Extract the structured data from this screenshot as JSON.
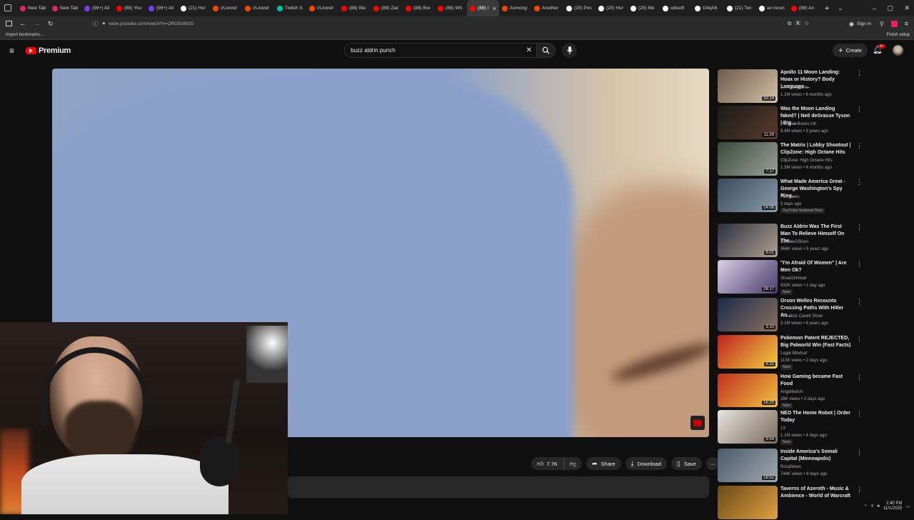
{
  "tabs": [
    {
      "label": "New Tab",
      "color": "#e0245e"
    },
    {
      "label": "New Tab",
      "color": "#e0245e"
    },
    {
      "label": "(99+) All",
      "color": "#7c3aed"
    },
    {
      "label": "(88) You",
      "color": "#ff0000"
    },
    {
      "label": "(99+) All",
      "color": "#7c3aed"
    },
    {
      "label": "(21) Hor",
      "color": "#ffffff"
    },
    {
      "label": "r/Livestr",
      "color": "#ff4500"
    },
    {
      "label": "r/Livestr",
      "color": "#ff4500"
    },
    {
      "label": "Twitch S",
      "color": "#00c2a8"
    },
    {
      "label": "r/Livestr",
      "color": "#ff4500"
    },
    {
      "label": "(88) Wa",
      "color": "#ff0000"
    },
    {
      "label": "(88) Zac",
      "color": "#ff0000"
    },
    {
      "label": "(88) Bre",
      "color": "#ff0000"
    },
    {
      "label": "(88) Wh",
      "color": "#ff0000"
    },
    {
      "label": "(88) I",
      "color": "#ff0000"
    },
    {
      "label": "Asmong",
      "color": "#ff4500"
    },
    {
      "label": "Another",
      "color": "#ff4500"
    },
    {
      "label": "(20) Pos",
      "color": "#ffffff"
    },
    {
      "label": "(20) Hor",
      "color": "#ffffff"
    },
    {
      "label": "(20) Me",
      "color": "#ffffff"
    },
    {
      "label": "ubisoft",
      "color": "#ffffff"
    },
    {
      "label": "G4qA6",
      "color": "#ffffff"
    },
    {
      "label": "(21) Twi",
      "color": "#ffffff"
    },
    {
      "label": "an incon",
      "color": "#ffffff"
    },
    {
      "label": "(88) An",
      "color": "#ff0000"
    }
  ],
  "active_tab_index": 14,
  "browser": {
    "url": "www.youtube.com/watch?v=ORO8z89zD",
    "bookmarks_label": "Import bookmarks...",
    "sign_in": "Sign in",
    "finish_setup": "Finish setup"
  },
  "youtube": {
    "logo_text": "Premium",
    "search_value": "buzz aldrin punch",
    "create_label": "Create",
    "notif_count": "9+"
  },
  "actions": {
    "likes": "7.7K",
    "share": "Share",
    "download": "Download",
    "save": "Save"
  },
  "recommendations": [
    {
      "title": "Apollo 11 Moon Landing: Hoax or History? Body Language ...",
      "channel": "Dr. G Explains",
      "stats": "1.1M views • 6 months ago",
      "duration": "33:14",
      "thumb": [
        "#6e5a4a",
        "#d3c1a8"
      ],
      "badge": ""
    },
    {
      "title": "Was the Moon Landing faked? | Neil deGrasse Tyson | Big ...",
      "channel": "Penguin Books UK",
      "stats": "9.4M views • 5 years ago",
      "duration": "11:29",
      "thumb": [
        "#1b1b1b",
        "#5a3a2a"
      ],
      "badge": ""
    },
    {
      "title": "The Matrix | Lobby Shootout | ClipZone: High Octane Hits",
      "channel": "ClipZone: High Octane Hits",
      "stats": "1.3M views • 4 months ago",
      "duration": "7:17",
      "thumb": [
        "#3a4a3a",
        "#9aa09a"
      ],
      "badge": ""
    },
    {
      "title": "What Made America Great - George Washington's Spy Ring...",
      "channel": "Fox News",
      "stats": "3 days ago",
      "duration": "14:06",
      "thumb": [
        "#3a4a5c",
        "#8a9aa8"
      ],
      "badge": "YouTube featured  New"
    },
    {
      "title": "Buzz Aldrin Was The First Man To Relieve Himself On The ...",
      "channel": "Conan O'Brien",
      "stats": "364K views • 5 years ago",
      "duration": "6:01",
      "thumb": [
        "#2a3040",
        "#b0a090"
      ],
      "badge": ""
    },
    {
      "title": "\"I'm Afraid Of Women\" | Are Men Ok?",
      "channel": "ShoeOnHead",
      "stats": "932K views • 1 day ago",
      "duration": "28:17",
      "thumb": [
        "#d8d0e8",
        "#4a3a6a"
      ],
      "badge": "New"
    },
    {
      "title": "Orson Welles Recounts Crossing Paths With Hitler An...",
      "channel": "The Dick Cavett Show",
      "stats": "3.1M views • 6 years ago",
      "duration": "3:10",
      "thumb": [
        "#1a2a4a",
        "#8a7060"
      ],
      "badge": ""
    },
    {
      "title": "Pokemon Patent REJECTED, Big Palworld Win (Fast Facts)",
      "channel": "Legal Mindset",
      "stats": "113K views • 2 days ago",
      "duration": "8:31",
      "thumb": [
        "#c02020",
        "#f0d040"
      ],
      "badge": "New"
    },
    {
      "title": "How Gaming became Fast Food",
      "channel": "AngelikaIsh",
      "stats": "26K views • 2 days ago",
      "duration": "16:25",
      "thumb": [
        "#c03020",
        "#f0c040"
      ],
      "badge": "New"
    },
    {
      "title": "NEO The Home Robot | Order Today",
      "channel": "1X",
      "stats": "1.1M views • 4 days ago",
      "duration": "9:54",
      "thumb": [
        "#e8e4e0",
        "#7a6a5a"
      ],
      "badge": "New"
    },
    {
      "title": "Inside America's Somali Capital (Minneapolis)",
      "channel": "RocaNews",
      "stats": "744K views • 8 days ago",
      "duration": "18:52",
      "thumb": [
        "#4a5a6a",
        "#a0a8b0"
      ],
      "badge": ""
    },
    {
      "title": "Taverns of Azeroth - Music & Ambience - World of Warcraft",
      "channel": "",
      "stats": "",
      "duration": "",
      "thumb": [
        "#6a4a1a",
        "#e0a040"
      ],
      "badge": ""
    }
  ],
  "taskbar": {
    "time": "2:40 PM",
    "date": "11/1/2025"
  }
}
